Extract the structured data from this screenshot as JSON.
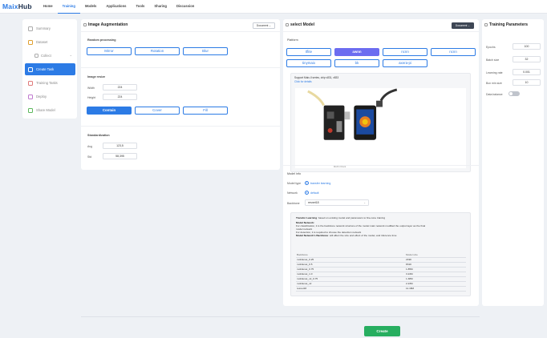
{
  "app": {
    "logo": {
      "part1": "Maix",
      "part2": "Hub"
    },
    "nav": [
      "Home",
      "Training",
      "Models",
      "Applications",
      "Tools",
      "Sharing",
      "Discussion"
    ],
    "nav_active": "Training"
  },
  "sidebar": {
    "items": [
      {
        "label": "Summary",
        "icon": "summary-icon",
        "active": false
      },
      {
        "label": "Dataset",
        "icon": "dataset-icon",
        "active": false
      },
      {
        "label": "Collect",
        "icon": "collect-icon",
        "active": false,
        "sub": true
      },
      {
        "label": "Create Task",
        "icon": "create-task-icon",
        "active": true
      },
      {
        "label": "Training Tasks",
        "icon": "training-tasks-icon",
        "active": false
      },
      {
        "label": "Deploy",
        "icon": "deploy-icon",
        "active": false
      },
      {
        "label": "Share Model",
        "icon": "share-model-icon",
        "active": false
      }
    ]
  },
  "augmentation": {
    "title": "Image Augmentation",
    "doc_label": "Document",
    "random_processing_label": "Random processing",
    "random_buttons": [
      "Mirror",
      "Rotation",
      "Blur"
    ],
    "resize_label": "Image resize",
    "width_label": "Width",
    "width_value": "224",
    "height_label": "Height",
    "height_value": "224",
    "resize_modes": [
      "Contain",
      "Cover",
      "Fill"
    ],
    "resize_mode_selected": "Contain",
    "standardization_label": "Standardization",
    "avg_label": "Avg",
    "avg_value": "123,5",
    "std_label": "Std",
    "std_value": "58,395"
  },
  "model": {
    "title": "select Model",
    "doc_label": "Document",
    "platform_label": "Platform",
    "platforms": [
      "tflite",
      "awnn",
      "ncnn",
      "ncnn",
      "tinymaix",
      "bk",
      "axera-pi"
    ],
    "platform_selected": "awnn",
    "support_text": "Support Maix-II series, chip v831, v833",
    "details_link": "Click for details",
    "image_caption": "MAIX-II Dock",
    "info_label": "Model info",
    "model_type_label": "Model type",
    "model_type_value": "transfer learning",
    "network_label": "Network",
    "network_value": "default",
    "backbone_label": "Backbone",
    "backbone_value": "resnet18",
    "info_box": {
      "transfer_title": "Transfer Learning",
      "transfer_text": ": based on existing model and parameters to fine-tune training",
      "network_title": "Model Network:",
      "network_text1": "For classification, it is the backbone network structure of the model main network modified the output layer as the final",
      "network_text2": "model network",
      "network_text3": "For detection, it is required to choose the detection network",
      "backbone_title": "Model Network's Backbone",
      "backbone_text": ": will affect the size and effect of the model, and inference time",
      "table_headers": [
        "Backbone",
        "Model size"
      ],
      "rows": [
        [
          "mobilenet_0.25",
          "219K"
        ],
        [
          "mobilenet_0.5",
          "831K"
        ],
        [
          "mobilenet_0.75",
          "1.85M"
        ],
        [
          "mobilenet_1.0",
          "3.24M"
        ],
        [
          "mobilenet_v2_0.75",
          "1.38M"
        ],
        [
          "mobilenet_v2",
          "2.23M"
        ],
        [
          "resnet18",
          "11.18M"
        ]
      ]
    }
  },
  "training": {
    "title": "Training Parameters",
    "params": [
      {
        "label": "Epochs",
        "value": "100"
      },
      {
        "label": "Batch size",
        "value": "32"
      },
      {
        "label": "Learning rate",
        "value": "0.001"
      },
      {
        "label": "Box min size",
        "value": "10"
      }
    ],
    "data_balance_label": "Data balance",
    "data_balance_on": false
  },
  "actions": {
    "create_label": "Create"
  },
  "colors": {
    "accent": "#2c7be5",
    "create": "#27ae60",
    "selected_platform": "#6c6cf0"
  }
}
